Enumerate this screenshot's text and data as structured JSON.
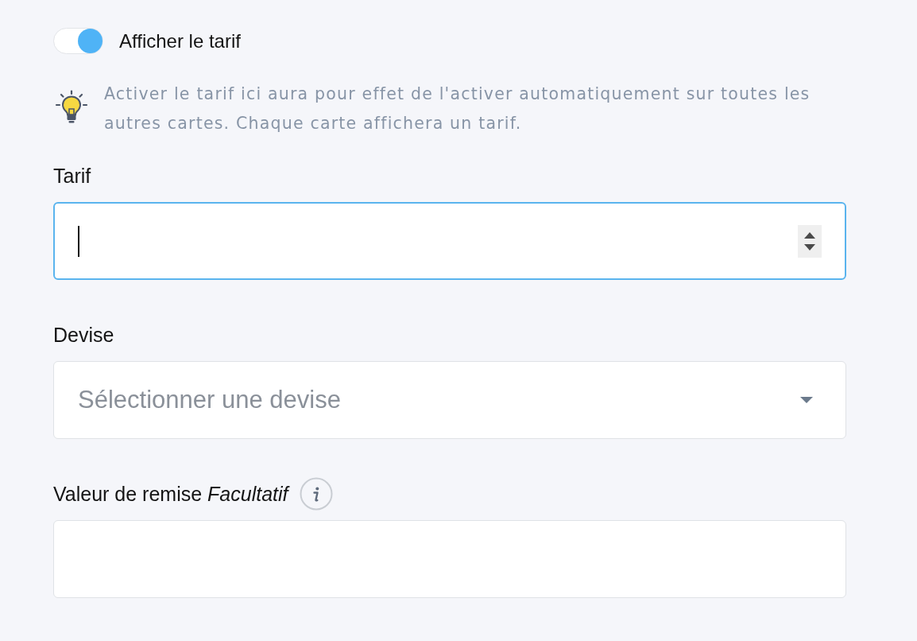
{
  "toggle": {
    "label": "Afficher le tarif",
    "on": true
  },
  "hint": {
    "text": "Activer le tarif ici aura pour effet de l'activer automatiquement sur toutes les autres cartes. Chaque carte affichera un tarif."
  },
  "fields": [
    {
      "kind": "number",
      "label": "Tarif",
      "focused": true
    },
    {
      "kind": "select",
      "label": "Devise",
      "placeholder": "Sélectionner une devise",
      "focused": false
    },
    {
      "kind": "text",
      "label": "Valeur de remise *Facultatif*",
      "info": true,
      "focused": false
    }
  ]
}
